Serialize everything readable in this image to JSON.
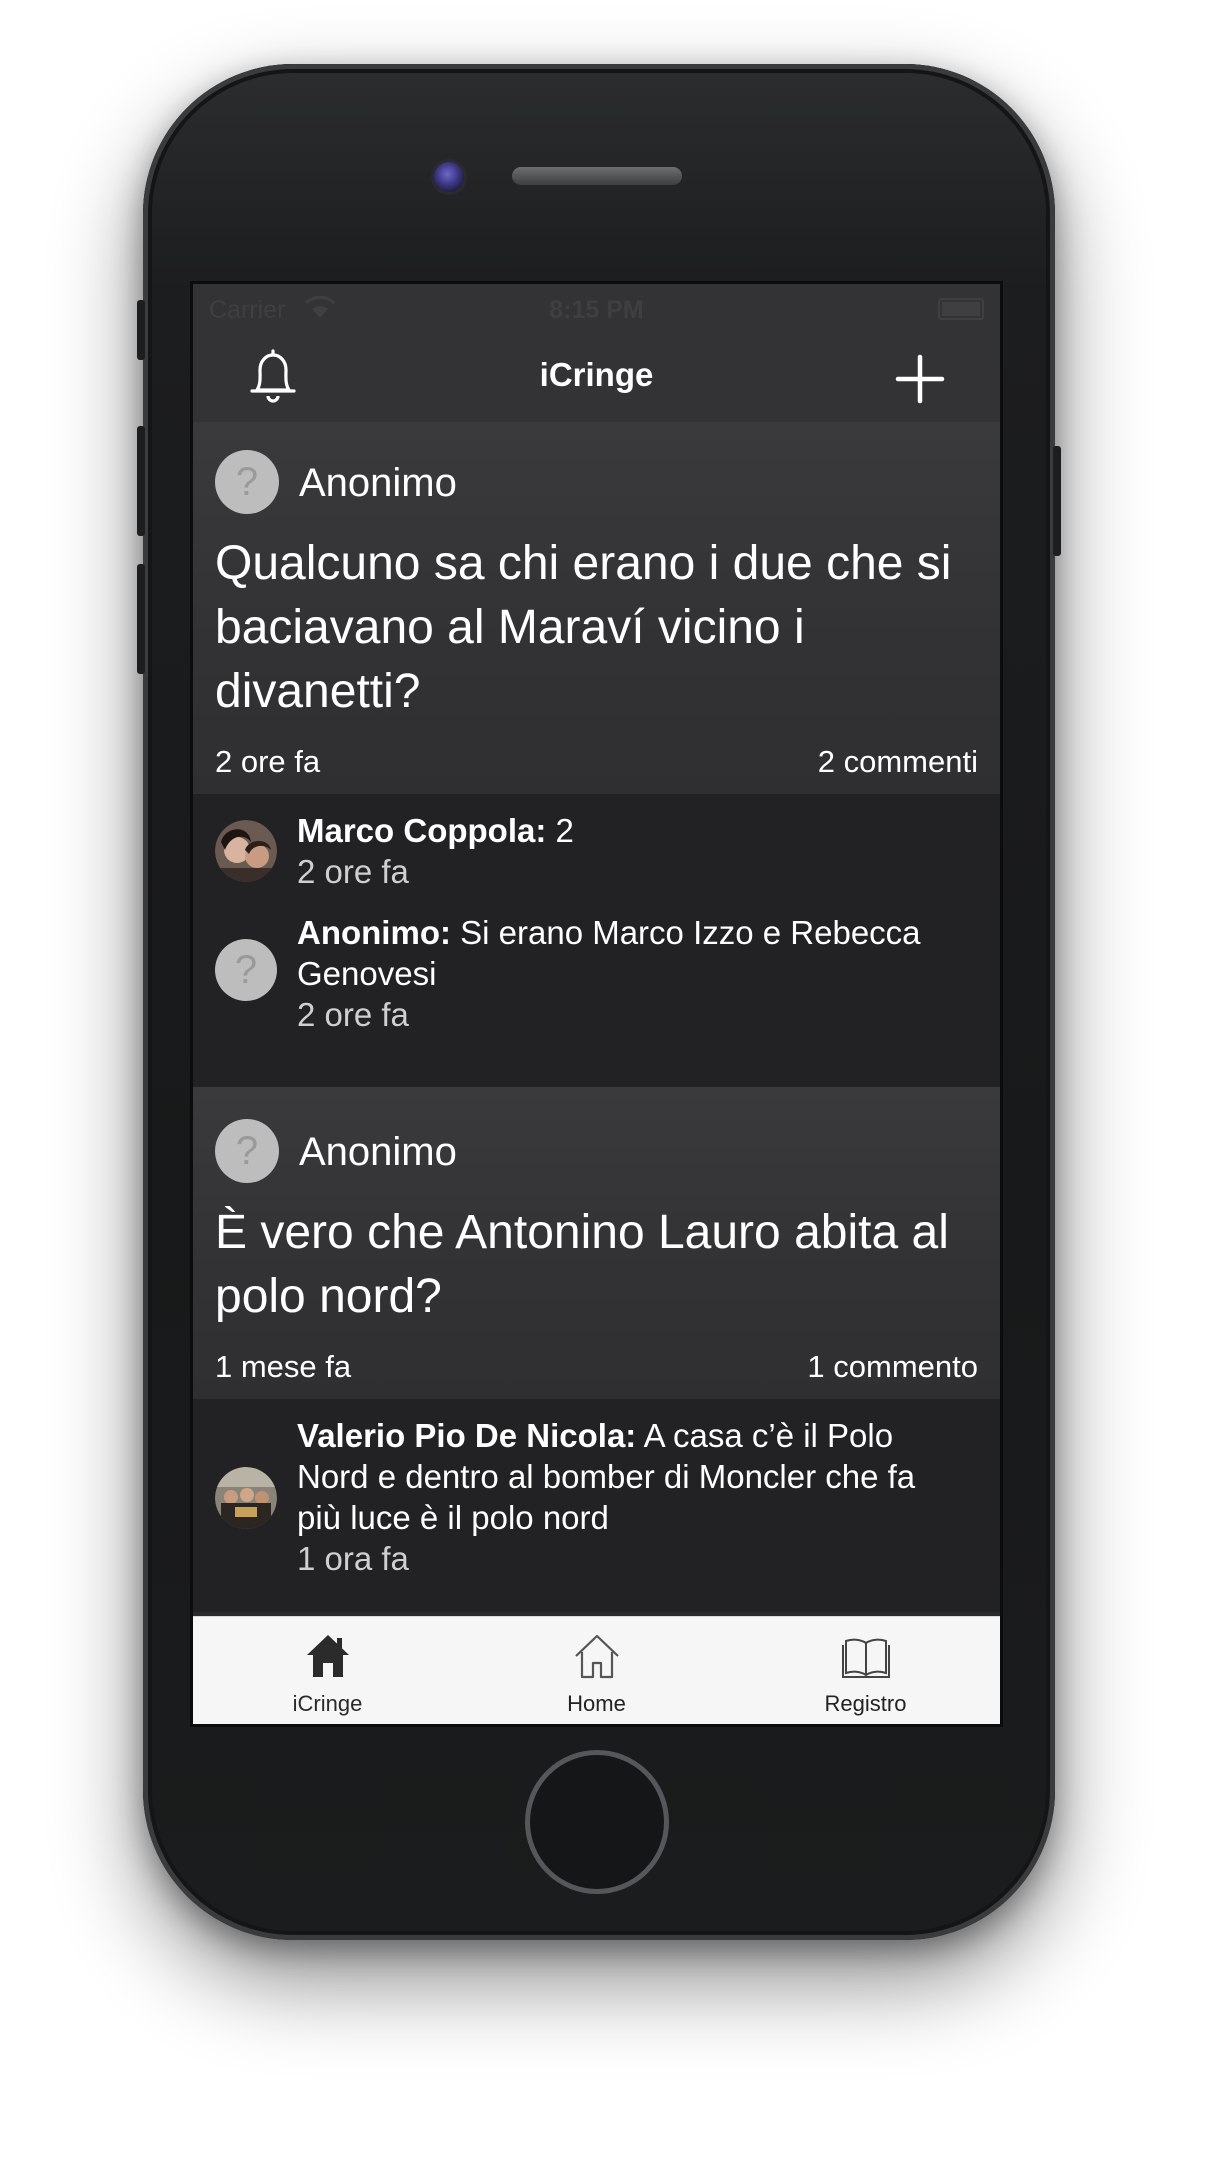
{
  "status_bar": {
    "carrier": "Carrier",
    "time": "8:15 PM"
  },
  "navbar": {
    "title": "iCringe",
    "left_icon": "bell-icon",
    "right_icon": "plus-icon"
  },
  "posts": [
    {
      "author": "Anonimo",
      "text": "Qualcuno sa chi erano i due che si baciavano al Maraví vicino i divanetti?",
      "time": "2 ore fa",
      "comment_count": "2 commenti",
      "comments": [
        {
          "author": "Marco Coppola:",
          "text": " 2",
          "time": "2 ore fa",
          "avatar": "photo"
        },
        {
          "author": "Anonimo:",
          "text": " Si erano Marco Izzo e Rebecca Genovesi",
          "time": "2 ore fa",
          "avatar": "anonymous"
        }
      ]
    },
    {
      "author": "Anonimo",
      "text": "È vero che Antonino Lauro abita al polo nord?",
      "time": "1 mese fa",
      "comment_count": "1 commento",
      "comments": [
        {
          "author": "Valerio Pio De Nicola:",
          "text": " A casa c’è il Polo Nord e dentro al bomber di Moncler che fa più luce è il polo nord",
          "time": "1 ora fa",
          "avatar": "photo"
        }
      ]
    }
  ],
  "tabbar": {
    "items": [
      {
        "label": "iCringe",
        "icon": "home-filled-icon"
      },
      {
        "label": "Home",
        "icon": "home-outline-icon"
      },
      {
        "label": "Registro",
        "icon": "book-icon"
      }
    ]
  },
  "colors": {
    "screen_bg": "#2a2a2c",
    "post_bg": "#3a3a3c",
    "comments_bg": "#222224",
    "tabbar_bg": "#f6f6f6",
    "text": "#ffffff"
  }
}
